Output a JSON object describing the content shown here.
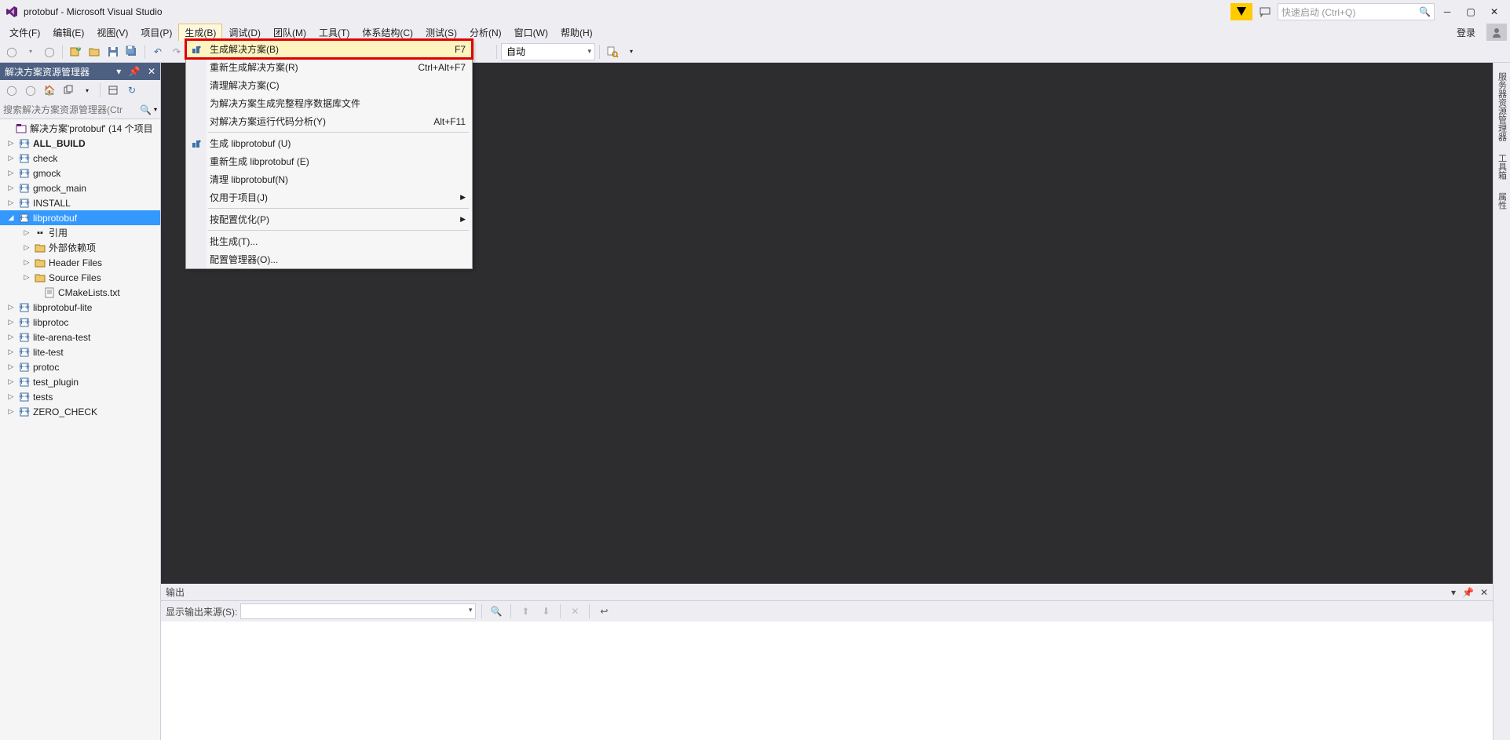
{
  "title": "protobuf - Microsoft Visual Studio",
  "quick_launch_placeholder": "快速启动 (Ctrl+Q)",
  "login_text": "登录",
  "menus": {
    "file": "文件(F)",
    "edit": "编辑(E)",
    "view": "视图(V)",
    "project": "项目(P)",
    "build": "生成(B)",
    "debug": "调试(D)",
    "team": "团队(M)",
    "tools": "工具(T)",
    "arch": "体系结构(C)",
    "test": "测试(S)",
    "analyze": "分析(N)",
    "window": "窗口(W)",
    "help": "帮助(H)"
  },
  "toolbar": {
    "config_auto": "自动"
  },
  "solution_explorer": {
    "title": "解决方案资源管理器",
    "search_placeholder": "搜索解决方案资源管理器(Ctr",
    "solution_label": "解决方案'protobuf' (14 个项目",
    "items": {
      "all_build": "ALL_BUILD",
      "check": "check",
      "gmock": "gmock",
      "gmock_main": "gmock_main",
      "install": "INSTALL",
      "libprotobuf": "libprotobuf",
      "refs": "引用",
      "extdeps": "外部依赖项",
      "headers": "Header Files",
      "sources": "Source Files",
      "cmake": "CMakeLists.txt",
      "libprotobuf_lite": "libprotobuf-lite",
      "libprotoc": "libprotoc",
      "lite_arena": "lite-arena-test",
      "lite_test": "lite-test",
      "protoc": "protoc",
      "test_plugin": "test_plugin",
      "tests": "tests",
      "zero_check": "ZERO_CHECK"
    }
  },
  "context_menu": {
    "build_solution": "生成解决方案(B)",
    "build_solution_sc": "F7",
    "rebuild_solution": "重新生成解决方案(R)",
    "rebuild_solution_sc": "Ctrl+Alt+F7",
    "clean_solution": "清理解决方案(C)",
    "gen_full_db": "为解决方案生成完整程序数据库文件",
    "code_analysis": "对解决方案运行代码分析(Y)",
    "code_analysis_sc": "Alt+F11",
    "build_lib": "生成 libprotobuf (U)",
    "rebuild_lib": "重新生成 libprotobuf (E)",
    "clean_lib": "清理 libprotobuf(N)",
    "project_only": "仅用于项目(J)",
    "optimize": "按配置优化(P)",
    "batch": "批生成(T)...",
    "config_mgr": "配置管理器(O)..."
  },
  "output": {
    "title": "输出",
    "show_from": "显示输出来源(S):"
  },
  "right_tabs": {
    "server_explorer": "服务器资源管理器",
    "toolbox": "工具箱",
    "properties": "属性"
  }
}
